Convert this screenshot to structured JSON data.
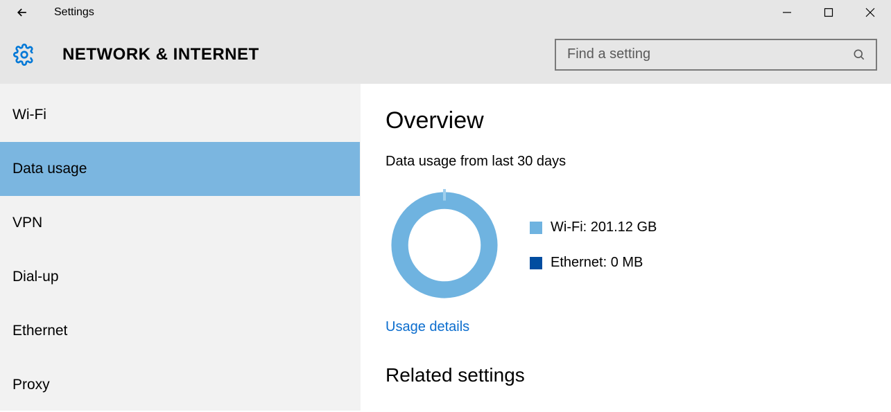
{
  "window": {
    "title": "Settings"
  },
  "header": {
    "category_title": "NETWORK & INTERNET",
    "search_placeholder": "Find a setting"
  },
  "sidebar": {
    "items": [
      {
        "label": "Wi-Fi",
        "selected": false
      },
      {
        "label": "Data usage",
        "selected": true
      },
      {
        "label": "VPN",
        "selected": false
      },
      {
        "label": "Dial-up",
        "selected": false
      },
      {
        "label": "Ethernet",
        "selected": false
      },
      {
        "label": "Proxy",
        "selected": false
      }
    ]
  },
  "main": {
    "overview_title": "Overview",
    "subtext": "Data usage from last 30 days",
    "legend": {
      "wifi": "Wi-Fi: 201.12 GB",
      "ethernet": "Ethernet: 0 MB"
    },
    "usage_details_link": "Usage details",
    "related_heading": "Related settings"
  },
  "chart_data": {
    "type": "pie",
    "title": "Data usage from last 30 days",
    "series": [
      {
        "name": "Wi-Fi",
        "value": 201.12,
        "unit": "GB",
        "color": "#6fb3e0"
      },
      {
        "name": "Ethernet",
        "value": 0,
        "unit": "MB",
        "color": "#014da0"
      }
    ]
  },
  "icons": {
    "back": "back-arrow-icon",
    "gear": "gear-icon",
    "search": "search-icon",
    "minimize": "minimize-icon",
    "maximize": "maximize-icon",
    "close": "close-icon"
  }
}
